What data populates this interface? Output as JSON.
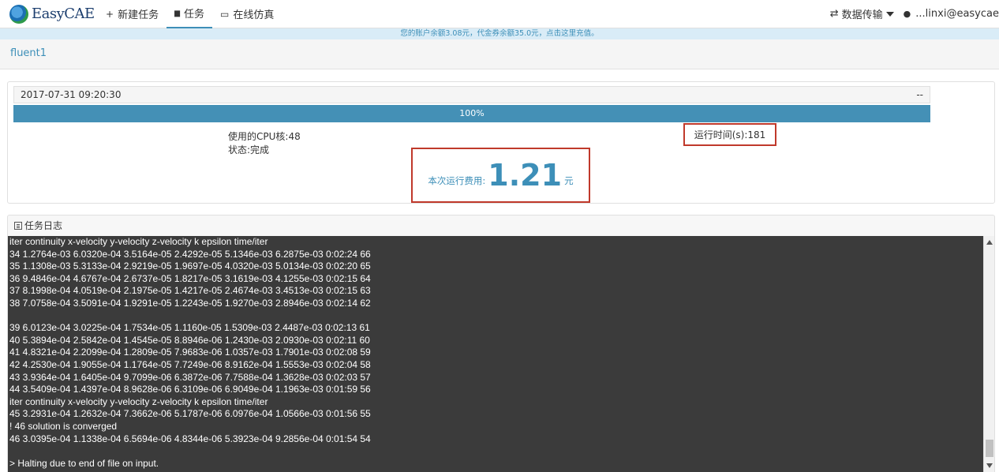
{
  "nav": {
    "logo_text": "EasyCAE",
    "items": [
      {
        "icon": "plus-icon",
        "glyph": "+",
        "label": "新建任务"
      },
      {
        "icon": "folder-icon",
        "glyph": "▆",
        "label": "任务"
      },
      {
        "icon": "monitor-icon",
        "glyph": "▭",
        "label": "在线仿真"
      }
    ],
    "data_transfer_label": "数据传输",
    "user_label": "...linxi@easycae"
  },
  "notice": "您的账户余额3.08元，代金券余额35.0元，点击这里充值。",
  "job_name": "fluent1",
  "status": {
    "timestamp": "2017-07-31 09:20:30",
    "right_text": "--",
    "progress_label": "100%",
    "progress": 1.0,
    "cpu_label": "使用的CPU核:48",
    "state_label": "状态:完成",
    "runtime_label": "运行时间(s):181",
    "cost_label": "本次运行费用:",
    "cost_value": "1.21",
    "cost_unit": "元"
  },
  "log": {
    "title": "任务日志",
    "lines": [
      "iter continuity x-velocity y-velocity z-velocity k epsilon time/iter",
      "34 1.2764e-03 6.0320e-04 3.5164e-05 2.4292e-05 5.1346e-03 6.2875e-03 0:02:24 66",
      "35 1.1308e-03 5.3133e-04 2.9219e-05 1.9697e-05 4.0320e-03 5.0134e-03 0:02:20 65",
      "36 9.4846e-04 4.6767e-04 2.6737e-05 1.8217e-05 3.1619e-03 4.1255e-03 0:02:15 64",
      "37 8.1998e-04 4.0519e-04 2.1975e-05 1.4217e-05 2.4674e-03 3.4513e-03 0:02:15 63",
      "38 7.0758e-04 3.5091e-04 1.9291e-05 1.2243e-05 1.9270e-03 2.8946e-03 0:02:14 62",
      "",
      "39 6.0123e-04 3.0225e-04 1.7534e-05 1.1160e-05 1.5309e-03 2.4487e-03 0:02:13 61",
      "40 5.3894e-04 2.5842e-04 1.4545e-05 8.8946e-06 1.2430e-03 2.0930e-03 0:02:11 60",
      "41 4.8321e-04 2.2099e-04 1.2809e-05 7.9683e-06 1.0357e-03 1.7901e-03 0:02:08 59",
      "42 4.2530e-04 1.9055e-04 1.1764e-05 7.7249e-06 8.9162e-04 1.5553e-03 0:02:04 58",
      "43 3.9364e-04 1.6405e-04 9.7099e-06 6.3872e-06 7.7588e-04 1.3628e-03 0:02:03 57",
      "44 3.5409e-04 1.4397e-04 8.9628e-06 6.3109e-06 6.9049e-04 1.1963e-03 0:01:59 56",
      "iter continuity x-velocity y-velocity z-velocity k epsilon time/iter",
      "45 3.2931e-04 1.2632e-04 7.3662e-06 5.1787e-06 6.0976e-04 1.0566e-03 0:01:56 55",
      "! 46 solution is converged",
      "46 3.0395e-04 1.1338e-04 6.5694e-06 4.8344e-06 5.3923e-04 9.2856e-04 0:01:54 54",
      "",
      "> Halting due to end of file on input."
    ]
  }
}
